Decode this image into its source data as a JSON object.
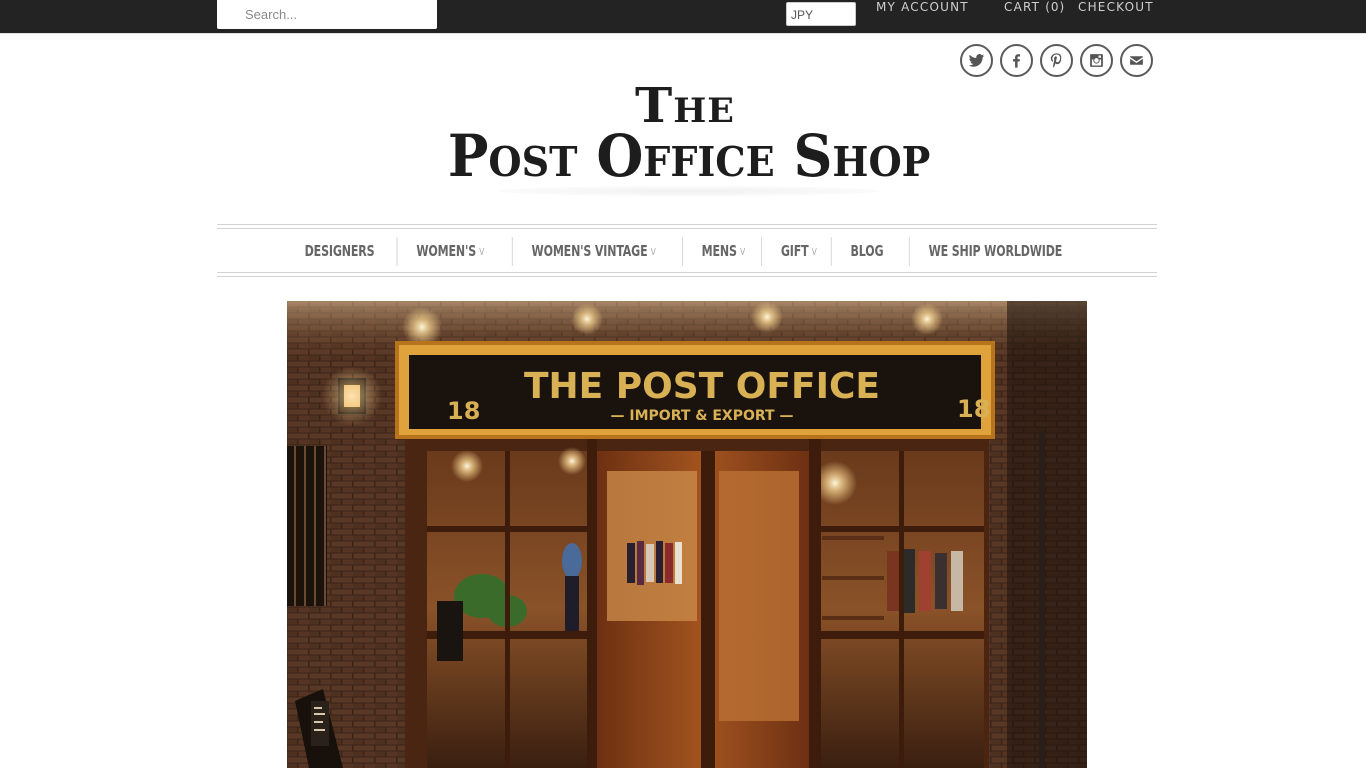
{
  "topbar": {
    "search_placeholder": "Search...",
    "currency": "JPY",
    "my_account": "MY ACCOUNT",
    "cart_label": "CART",
    "cart_count": "(0)",
    "checkout": "CHECKOUT"
  },
  "social": [
    "twitter-icon",
    "facebook-icon",
    "pinterest-icon",
    "instagram-icon",
    "email-icon"
  ],
  "logo": {
    "line1": "The",
    "line2": "Post Office Shop"
  },
  "nav": {
    "items": [
      {
        "label": "DESIGNERS",
        "has_dropdown": false
      },
      {
        "label": "WOMEN'S",
        "has_dropdown": true
      },
      {
        "label": "WOMEN'S VINTAGE",
        "has_dropdown": true
      },
      {
        "label": "MENS",
        "has_dropdown": true
      },
      {
        "label": "GIFT",
        "has_dropdown": true
      },
      {
        "label": "BLOG",
        "has_dropdown": false
      },
      {
        "label": "WE SHIP WORLDWIDE",
        "has_dropdown": false
      }
    ],
    "dropdown_glyph": "v"
  },
  "hero": {
    "sign_title": "THE POST OFFICE",
    "sign_subtitle": "— IMPORT & EXPORT —",
    "sign_number_left": "18",
    "sign_number_right": "18"
  },
  "colors": {
    "topbar_bg": "#232323",
    "nav_text": "#666666",
    "sign_gold": "#d9b155"
  }
}
